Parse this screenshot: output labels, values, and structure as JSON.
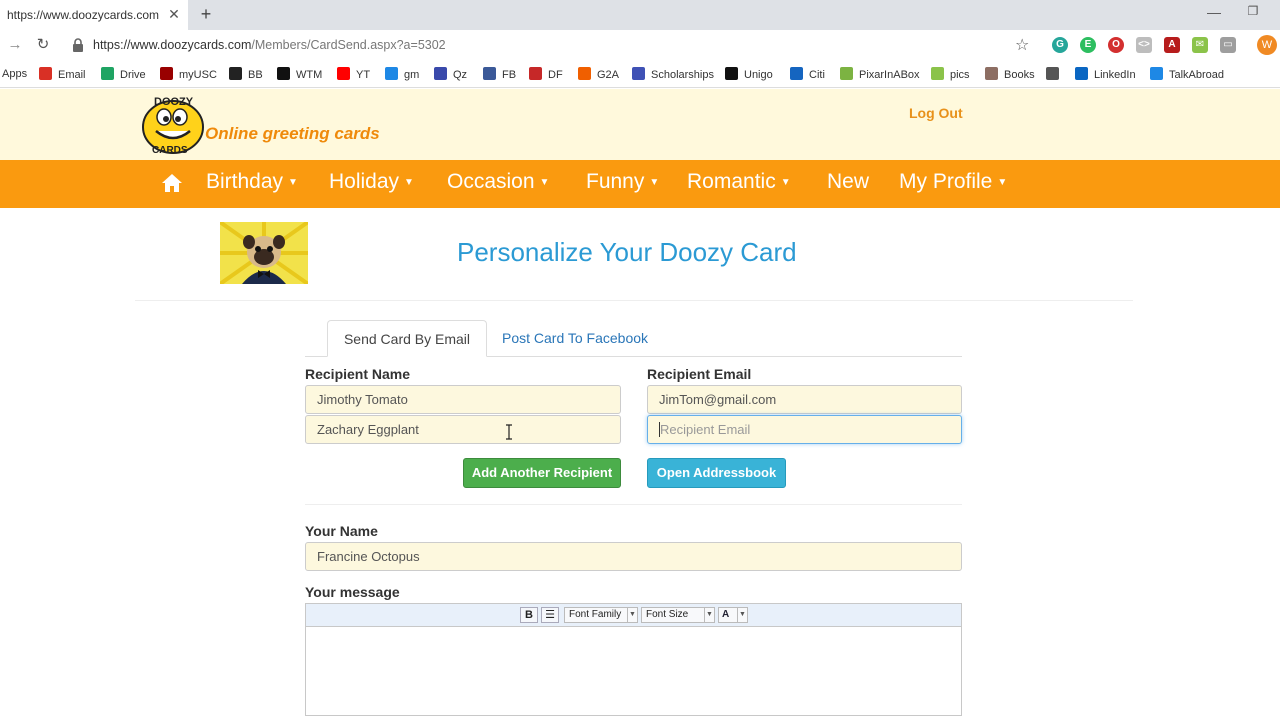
{
  "browser": {
    "tab_title": "https://www.doozycards.com/Me",
    "new_tab": "+",
    "url_host": "https://www.doozycards.com",
    "url_path": "/Members/CardSend.aspx?a=5302",
    "profile_initial": "W"
  },
  "bookmarks": [
    {
      "label": "Apps",
      "icon": "apps-icon",
      "color": "#5f6368"
    },
    {
      "label": "Email",
      "icon": "gmail-icon",
      "color": "#d93025"
    },
    {
      "label": "Drive",
      "icon": "drive-icon",
      "color": "#1fa463"
    },
    {
      "label": "myUSC",
      "icon": "usc-icon",
      "color": "#990000"
    },
    {
      "label": "BB",
      "icon": "bb-icon",
      "color": "#222222"
    },
    {
      "label": "WTM",
      "icon": "wtm-icon",
      "color": "#111111"
    },
    {
      "label": "YT",
      "icon": "youtube-icon",
      "color": "#ff0000"
    },
    {
      "label": "gm",
      "icon": "gm-icon",
      "color": "#1e88e5"
    },
    {
      "label": "Qz",
      "icon": "quizlet-icon",
      "color": "#3949ab"
    },
    {
      "label": "FB",
      "icon": "facebook-icon",
      "color": "#3b5998"
    },
    {
      "label": "DF",
      "icon": "df-icon",
      "color": "#c62828"
    },
    {
      "label": "G2A",
      "icon": "g2a-icon",
      "color": "#f05f00"
    },
    {
      "label": "Scholarships",
      "icon": "scholarships-icon",
      "color": "#3f51b5"
    },
    {
      "label": "Unigo",
      "icon": "unigo-icon",
      "color": "#111111"
    },
    {
      "label": "Citi",
      "icon": "citi-icon",
      "color": "#1565c0"
    },
    {
      "label": "PixarInABox",
      "icon": "leaf-icon",
      "color": "#7cb342"
    },
    {
      "label": "pics",
      "icon": "pics-icon",
      "color": "#8bc34a"
    },
    {
      "label": "Books",
      "icon": "goodreads-icon",
      "color": "#8d6e63"
    },
    {
      "label": "",
      "icon": "globe-icon",
      "color": "#555555"
    },
    {
      "label": "LinkedIn",
      "icon": "linkedin-icon",
      "color": "#0a66c2"
    },
    {
      "label": "TalkAbroad",
      "icon": "talkabroad-icon",
      "color": "#1e88e5"
    }
  ],
  "header": {
    "tagline": "Online greeting cards",
    "logout": "Log Out"
  },
  "nav": [
    {
      "label": "Birthday",
      "dropdown": true
    },
    {
      "label": "Holiday",
      "dropdown": true
    },
    {
      "label": "Occasion",
      "dropdown": true
    },
    {
      "label": "Funny",
      "dropdown": true
    },
    {
      "label": "Romantic",
      "dropdown": true
    },
    {
      "label": "New",
      "dropdown": false
    },
    {
      "label": "My Profile",
      "dropdown": true
    }
  ],
  "page": {
    "title": "Personalize Your Doozy Card",
    "tab_email": "Send Card By Email",
    "tab_facebook": "Post Card To Facebook"
  },
  "form": {
    "recipient_name_label": "Recipient Name",
    "recipient_email_label": "Recipient Email",
    "recipients": [
      {
        "name": "Jimothy Tomato",
        "email": "JimTom@gmail.com"
      },
      {
        "name": "Zachary Eggplant",
        "email": ""
      }
    ],
    "email_placeholder": "Recipient Email",
    "add_recipient": "Add Another Recipient",
    "open_addressbook": "Open Addressbook",
    "your_name_label": "Your Name",
    "your_name": "Francine Octopus",
    "message_label": "Your message"
  },
  "editor": {
    "bold": "B",
    "font_family": "Font Family",
    "font_size": "Font Size",
    "text_color": "A"
  },
  "colors": {
    "nav_orange": "#fa9a0f",
    "header_cream": "#fff9dc",
    "title_blue": "#2b9ad4",
    "button_green": "#4cae4c",
    "button_blue": "#39b3d7"
  }
}
